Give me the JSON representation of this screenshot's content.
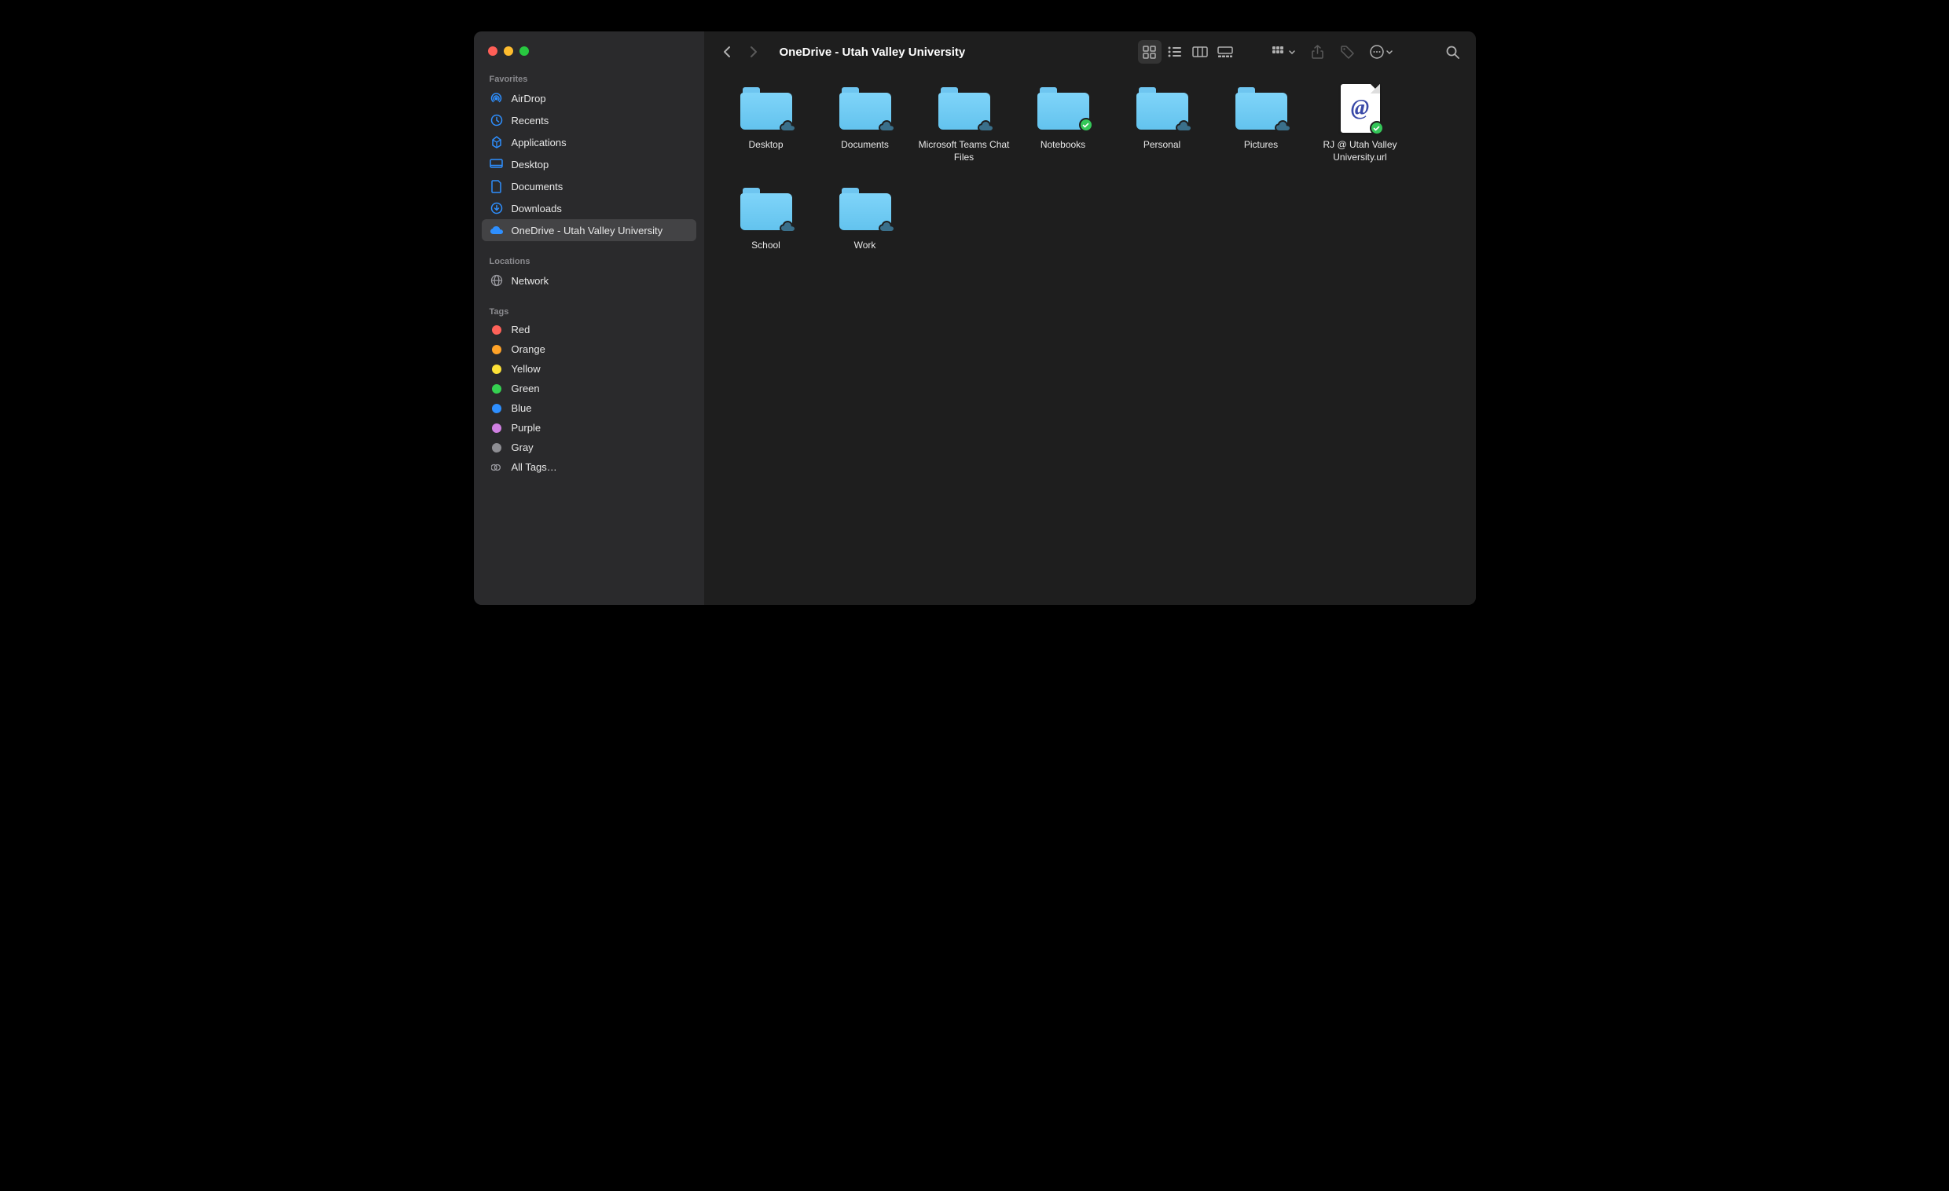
{
  "window_title": "OneDrive - Utah Valley University",
  "sidebar": {
    "sections": [
      {
        "header": "Favorites",
        "items": [
          {
            "label": "AirDrop",
            "icon": "airdrop",
            "selected": false
          },
          {
            "label": "Recents",
            "icon": "recents",
            "selected": false
          },
          {
            "label": "Applications",
            "icon": "applications",
            "selected": false
          },
          {
            "label": "Desktop",
            "icon": "desktop",
            "selected": false
          },
          {
            "label": "Documents",
            "icon": "documents",
            "selected": false
          },
          {
            "label": "Downloads",
            "icon": "downloads",
            "selected": false
          },
          {
            "label": "OneDrive - Utah Valley University",
            "icon": "cloud",
            "selected": true
          }
        ]
      },
      {
        "header": "Locations",
        "items": [
          {
            "label": "Network",
            "icon": "network",
            "selected": false
          }
        ]
      },
      {
        "header": "Tags",
        "items": [
          {
            "label": "Red",
            "tag_color": "red"
          },
          {
            "label": "Orange",
            "tag_color": "orange"
          },
          {
            "label": "Yellow",
            "tag_color": "yellow"
          },
          {
            "label": "Green",
            "tag_color": "green"
          },
          {
            "label": "Blue",
            "tag_color": "blue"
          },
          {
            "label": "Purple",
            "tag_color": "purple"
          },
          {
            "label": "Gray",
            "tag_color": "gray"
          },
          {
            "label": "All Tags…",
            "tag_color": "all"
          }
        ]
      }
    ]
  },
  "toolbar": {
    "back_enabled": true,
    "forward_enabled": false,
    "active_view": "icons"
  },
  "files": [
    {
      "name": "Desktop",
      "type": "folder",
      "badge": "cloud"
    },
    {
      "name": "Documents",
      "type": "folder",
      "badge": "cloud"
    },
    {
      "name": "Microsoft Teams Chat Files",
      "type": "folder",
      "badge": "cloud"
    },
    {
      "name": "Notebooks",
      "type": "folder",
      "badge": "synced"
    },
    {
      "name": "Personal",
      "type": "folder",
      "badge": "cloud"
    },
    {
      "name": "Pictures",
      "type": "folder",
      "badge": "cloud"
    },
    {
      "name": "RJ @ Utah Valley University.url",
      "type": "url",
      "badge": "synced"
    },
    {
      "name": "School",
      "type": "folder",
      "badge": "cloud"
    },
    {
      "name": "Work",
      "type": "folder",
      "badge": "cloud"
    }
  ]
}
